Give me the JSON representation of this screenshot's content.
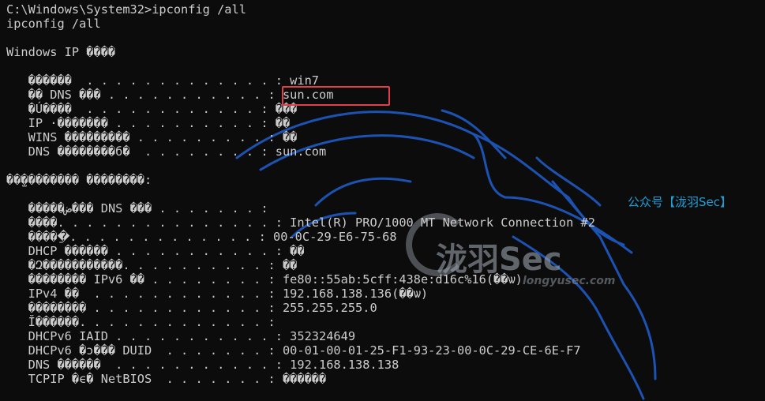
{
  "terminal": {
    "lines": [
      "C:\\Windows\\System32>ipconfig /all",
      "ipconfig /all",
      "",
      "Windows IP ����",
      "",
      "   ������  . . . . . . . . . . . . . : win7",
      "   �� DNS ��� . . . . . . . . . . . : sun.com",
      "   �Ú����  . . . . . . . . . . . . : ���",
      "   IP ·������� . . . . . . . . . . : ��",
      "   WINS ��������� . . . . . . . . . : ��",
      "   DNS ��������б�  . . . . . . . . : sun.com",
      "",
      "��̫�������� ��������:",
      "",
      "   �����ض��� DNS ��� . . . . . . . :",
      "   ����. . . . . . . . . . . . . . . : Intel(R) PRO/1000 MT Network Connection #2",
      "   �����ַ. . . . . . . . . . . . . : 00-0C-29-E6-75-68",
      "   DHCP ������ . . . . . . . . . . . : ��",
      "   �Զ�����������. . . . . . . . . . : ��",
      "   �������� IPv6 �� . . . . . . . . : fe80::55ab:5cff:438e:d16c%16(��ѡ)",
      "   IPv4 ��  . . . . . . . . . . . . : 192.168.138.136(��ѡ)",
      "   �������� . . . . . . . . . . . . : 255.255.255.0",
      "   Ĭ������. . . . . . . . . . . . . :",
      "   DHCPv6 IAID . . . . . . . . . . . : 352324649",
      "   DHCPv6 �ͻ��� DUID  . . . . . . . : 00-01-00-01-25-F1-93-23-00-0C-29-CE-6E-F7",
      "   DNS ������  . . . . . . . . . . . : 192.168.138.138",
      "   TCPIP �ϵ� NetBIOS  . . . . . . . : ������"
    ]
  },
  "watermark": {
    "account_text": "公众号【泷羽Sec】",
    "logo_text": "泷羽Sec",
    "logo_sub": "longyusec.com"
  },
  "colors": {
    "background": "#0c0c0c",
    "text": "#cccccc",
    "highlight_box": "#e0404a",
    "dragon": "#1f5fd0",
    "watermark_blue": "#1e9fd8"
  }
}
